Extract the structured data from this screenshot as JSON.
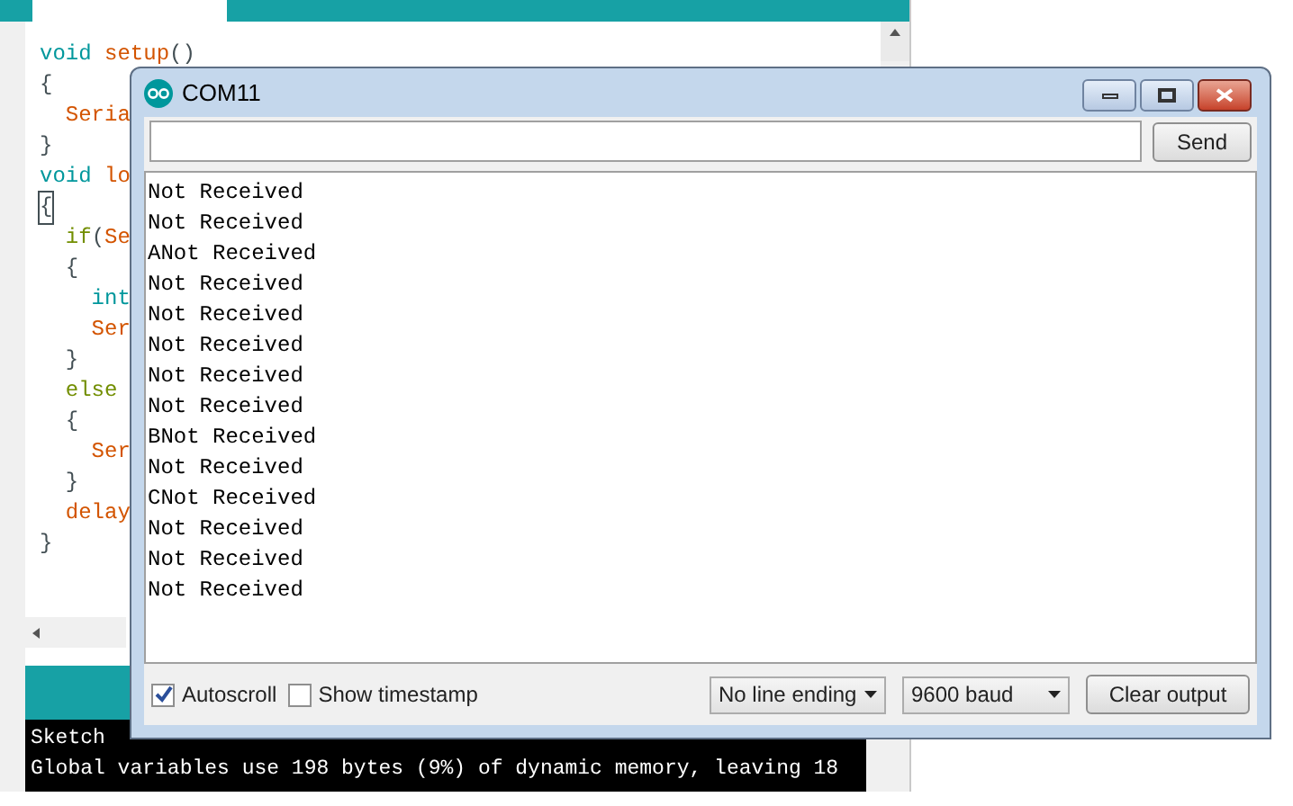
{
  "ide": {
    "code_lines": [
      {
        "tokens": [
          {
            "text": "void",
            "kind": "type"
          },
          {
            "text": " setup",
            "kind": "func"
          },
          {
            "text": "()",
            "kind": "plain"
          }
        ],
        "highlighted": false
      },
      {
        "tokens": [
          {
            "text": "{",
            "kind": "plain"
          }
        ],
        "highlighted": false
      },
      {
        "tokens": [
          {
            "text": "  Seria",
            "kind": "func"
          }
        ],
        "highlighted": false
      },
      {
        "tokens": [
          {
            "text": "}",
            "kind": "plain"
          }
        ],
        "highlighted": false
      },
      {
        "tokens": [
          {
            "text": "void",
            "kind": "type"
          },
          {
            "text": " lo",
            "kind": "func"
          }
        ],
        "highlighted": false
      },
      {
        "tokens": [
          {
            "text": "{",
            "kind": "plain"
          }
        ],
        "highlighted": true
      },
      {
        "tokens": [
          {
            "text": "  if",
            "kind": "keyword"
          },
          {
            "text": "(",
            "kind": "plain"
          },
          {
            "text": "Se",
            "kind": "func"
          }
        ],
        "highlighted": false
      },
      {
        "tokens": [
          {
            "text": "  {",
            "kind": "plain"
          }
        ],
        "highlighted": false
      },
      {
        "tokens": [
          {
            "text": "    int",
            "kind": "type"
          }
        ],
        "highlighted": false
      },
      {
        "tokens": [
          {
            "text": "    Ser",
            "kind": "func"
          }
        ],
        "highlighted": false
      },
      {
        "tokens": [
          {
            "text": "  }",
            "kind": "plain"
          }
        ],
        "highlighted": false
      },
      {
        "tokens": [
          {
            "text": "  else",
            "kind": "keyword"
          }
        ],
        "highlighted": false
      },
      {
        "tokens": [
          {
            "text": "  {",
            "kind": "plain"
          }
        ],
        "highlighted": false
      },
      {
        "tokens": [
          {
            "text": "    Ser",
            "kind": "func"
          }
        ],
        "highlighted": false
      },
      {
        "tokens": [
          {
            "text": "  }",
            "kind": "plain"
          }
        ],
        "highlighted": false
      },
      {
        "tokens": [
          {
            "text": "  delay",
            "kind": "func"
          }
        ],
        "highlighted": false
      },
      {
        "tokens": [
          {
            "text": "}",
            "kind": "plain"
          }
        ],
        "highlighted": false
      }
    ],
    "console": [
      "Sketch",
      "Global variables use 198 bytes (9%) of dynamic memory, leaving 18"
    ]
  },
  "serial_monitor": {
    "title": "COM11",
    "send_label": "Send",
    "output": [
      "Not Received",
      "Not Received",
      "ANot Received",
      "Not Received",
      "Not Received",
      "Not Received",
      "Not Received",
      "Not Received",
      "BNot Received",
      "Not Received",
      "CNot Received",
      "Not Received",
      "Not Received",
      "Not Received"
    ],
    "autoscroll": {
      "label": "Autoscroll",
      "checked": true
    },
    "show_timestamp": {
      "label": "Show timestamp",
      "checked": false
    },
    "line_ending": "No line ending",
    "baud": "9600 baud",
    "clear_label": "Clear output"
  }
}
